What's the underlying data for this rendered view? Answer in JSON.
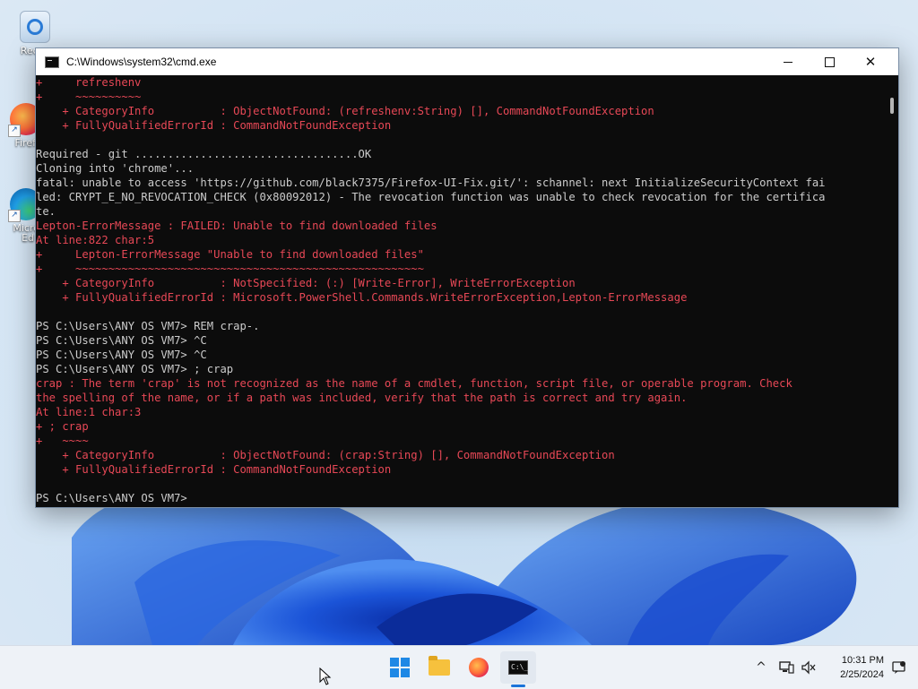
{
  "desktop": {
    "icons": [
      {
        "label": "Recyc",
        "icon": "recycle-bin-icon"
      },
      {
        "label": "Firef",
        "icon": "firefox-shortcut-icon"
      },
      {
        "label": "Micro",
        "label2": "Ed",
        "icon": "edge-shortcut-icon"
      }
    ]
  },
  "window": {
    "title": "C:\\Windows\\system32\\cmd.exe",
    "buttons": {
      "minimize": "—",
      "maximize": "☐",
      "close": "✕"
    },
    "console_lines": [
      {
        "text": "+     refreshenv",
        "type": "err"
      },
      {
        "text": "+     ~~~~~~~~~~",
        "type": "err"
      },
      {
        "text": "    + CategoryInfo          : ObjectNotFound: (refreshenv:String) [], CommandNotFoundException",
        "type": "err"
      },
      {
        "text": "    + FullyQualifiedErrorId : CommandNotFoundException",
        "type": "err"
      },
      {
        "text": "",
        "type": "out"
      },
      {
        "text": "Required - git ..................................OK",
        "type": "out"
      },
      {
        "text": "Cloning into 'chrome'...",
        "type": "out"
      },
      {
        "text": "fatal: unable to access 'https://github.com/black7375/Firefox-UI-Fix.git/': schannel: next InitializeSecurityContext fai",
        "type": "out"
      },
      {
        "text": "led: CRYPT_E_NO_REVOCATION_CHECK (0x80092012) - The revocation function was unable to check revocation for the certifica",
        "type": "out"
      },
      {
        "text": "te.",
        "type": "out"
      },
      {
        "text": "Lepton-ErrorMessage : FAILED: Unable to find downloaded files",
        "type": "err"
      },
      {
        "text": "At line:822 char:5",
        "type": "err"
      },
      {
        "text": "+     Lepton-ErrorMessage \"Unable to find downloaded files\"",
        "type": "err"
      },
      {
        "text": "+     ~~~~~~~~~~~~~~~~~~~~~~~~~~~~~~~~~~~~~~~~~~~~~~~~~~~~~",
        "type": "err"
      },
      {
        "text": "    + CategoryInfo          : NotSpecified: (:) [Write-Error], WriteErrorException",
        "type": "err"
      },
      {
        "text": "    + FullyQualifiedErrorId : Microsoft.PowerShell.Commands.WriteErrorException,Lepton-ErrorMessage",
        "type": "err"
      },
      {
        "text": "",
        "type": "out"
      },
      {
        "text": "PS C:\\Users\\ANY OS VM7> REM crap-.",
        "type": "out"
      },
      {
        "text": "PS C:\\Users\\ANY OS VM7> ^C",
        "type": "out"
      },
      {
        "text": "PS C:\\Users\\ANY OS VM7> ^C",
        "type": "out"
      },
      {
        "text": "PS C:\\Users\\ANY OS VM7> ; crap",
        "type": "out"
      },
      {
        "text": "crap : The term 'crap' is not recognized as the name of a cmdlet, function, script file, or operable program. Check",
        "type": "err"
      },
      {
        "text": "the spelling of the name, or if a path was included, verify that the path is correct and try again.",
        "type": "err"
      },
      {
        "text": "At line:1 char:3",
        "type": "err"
      },
      {
        "text": "+ ; crap",
        "type": "err"
      },
      {
        "text": "+   ~~~~",
        "type": "err"
      },
      {
        "text": "    + CategoryInfo          : ObjectNotFound: (crap:String) [], CommandNotFoundException",
        "type": "err"
      },
      {
        "text": "    + FullyQualifiedErrorId : CommandNotFoundException",
        "type": "err"
      },
      {
        "text": "",
        "type": "out"
      },
      {
        "text": "PS C:\\Users\\ANY OS VM7>",
        "type": "out"
      }
    ],
    "colors": {
      "error": "#e74856",
      "output": "#cccccc",
      "background": "#0c0c0c"
    }
  },
  "taskbar": {
    "apps": [
      {
        "name": "start-button",
        "icon": "windows-logo-icon"
      },
      {
        "name": "file-explorer",
        "icon": "folder-icon"
      },
      {
        "name": "firefox",
        "icon": "firefox-icon"
      },
      {
        "name": "command-prompt",
        "icon": "terminal-icon",
        "active": true
      }
    ],
    "tray": {
      "chevron": "^",
      "time": "10:31 PM",
      "date": "2/25/2024"
    }
  }
}
